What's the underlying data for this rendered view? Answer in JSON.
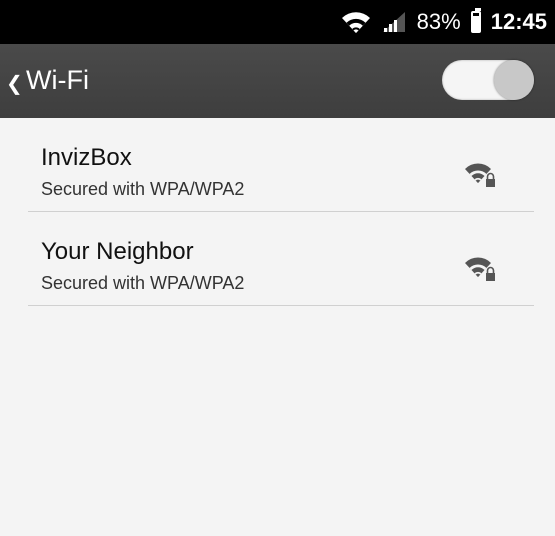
{
  "status_bar": {
    "battery_percent": "83%",
    "battery_level": 0.83,
    "time": "12:45",
    "icons": [
      "wifi-icon",
      "signal-icon",
      "battery-icon"
    ]
  },
  "action_bar": {
    "title": "Wi-Fi",
    "back_icon": "chevron-left-icon",
    "toggle_state": "on"
  },
  "networks": [
    {
      "name": "InvizBox",
      "security": "Secured with WPA/WPA2",
      "icon": "wifi-lock-icon"
    },
    {
      "name": "Your Neighbor",
      "security": "Secured with WPA/WPA2",
      "icon": "wifi-lock-icon"
    }
  ],
  "colors": {
    "status_bar_bg": "#000000",
    "action_bar_bg": "#444444",
    "list_bg": "#f4f4f4",
    "divider": "#d0d0d0"
  }
}
